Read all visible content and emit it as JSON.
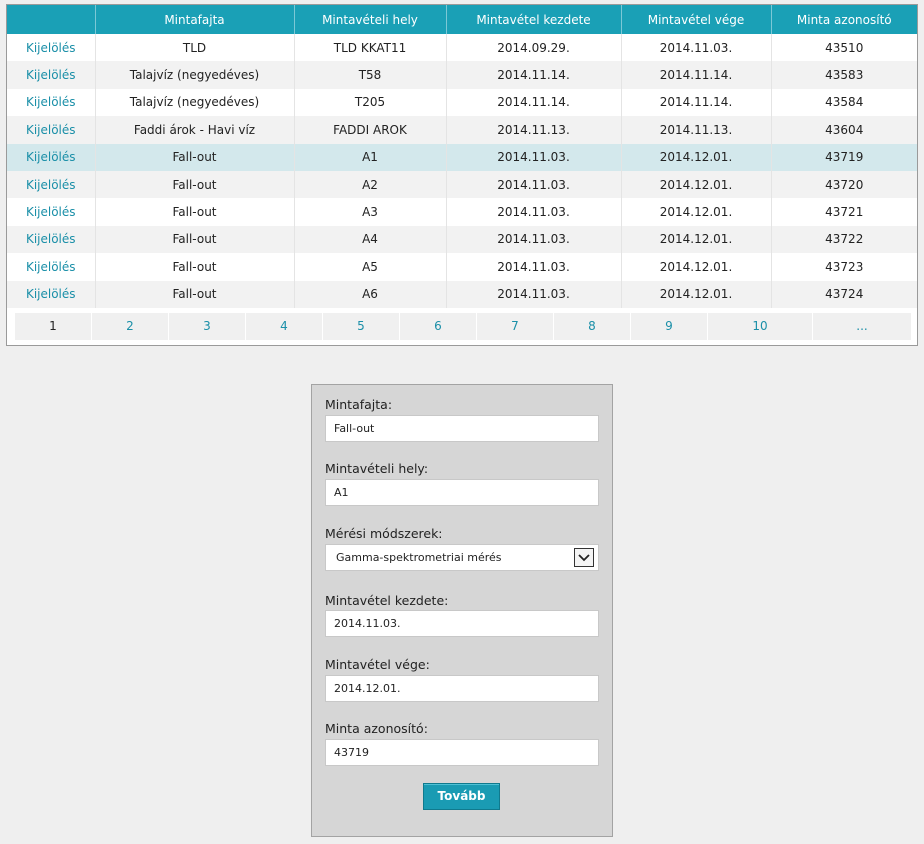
{
  "grid": {
    "columns": [
      "",
      "Mintafajta",
      "Mintavételi hely",
      "Mintavétel kezdete",
      "Mintavétel vége",
      "Minta azonosító"
    ],
    "rows": [
      {
        "action": "Kijelölés",
        "type": "TLD",
        "place": "TLD KKAT11",
        "start": "2014.09.29.",
        "end": "2014.11.03.",
        "id": "43510"
      },
      {
        "action": "Kijelölés",
        "type": "Talajvíz (negyedéves)",
        "place": "T58",
        "start": "2014.11.14.",
        "end": "2014.11.14.",
        "id": "43583"
      },
      {
        "action": "Kijelölés",
        "type": "Talajvíz (negyedéves)",
        "place": "T205",
        "start": "2014.11.14.",
        "end": "2014.11.14.",
        "id": "43584"
      },
      {
        "action": "Kijelölés",
        "type": "Faddi árok - Havi víz",
        "place": "FADDI AROK",
        "start": "2014.11.13.",
        "end": "2014.11.13.",
        "id": "43604"
      },
      {
        "action": "Kijelölés",
        "type": "Fall-out",
        "place": "A1",
        "start": "2014.11.03.",
        "end": "2014.12.01.",
        "id": "43719"
      },
      {
        "action": "Kijelölés",
        "type": "Fall-out",
        "place": "A2",
        "start": "2014.11.03.",
        "end": "2014.12.01.",
        "id": "43720"
      },
      {
        "action": "Kijelölés",
        "type": "Fall-out",
        "place": "A3",
        "start": "2014.11.03.",
        "end": "2014.12.01.",
        "id": "43721"
      },
      {
        "action": "Kijelölés",
        "type": "Fall-out",
        "place": "A4",
        "start": "2014.11.03.",
        "end": "2014.12.01.",
        "id": "43722"
      },
      {
        "action": "Kijelölés",
        "type": "Fall-out",
        "place": "A5",
        "start": "2014.11.03.",
        "end": "2014.12.01.",
        "id": "43723"
      },
      {
        "action": "Kijelölés",
        "type": "Fall-out",
        "place": "A6",
        "start": "2014.11.03.",
        "end": "2014.12.01.",
        "id": "43724"
      }
    ],
    "selected_row": 4
  },
  "pager": {
    "pages": [
      "1",
      "2",
      "3",
      "4",
      "5",
      "6",
      "7",
      "8",
      "9",
      "10",
      "..."
    ],
    "current": "1"
  },
  "form": {
    "type_label": "Mintafajta:",
    "type_value": "Fall-out",
    "place_label": "Mintavételi hely:",
    "place_value": "A1",
    "method_label": "Mérési módszerek:",
    "method_value": "Gamma-spektrometriai mérés",
    "start_label": "Mintavétel kezdete:",
    "start_value": "2014.11.03.",
    "end_label": "Mintavétel vége:",
    "end_value": "2014.12.01.",
    "id_label": "Minta azonosító:",
    "id_value": "43719",
    "next_button": "Tovább"
  },
  "colors": {
    "header_bg": "#1aa0b6",
    "link": "#1a8fa8",
    "selected_row_bg": "#d3e8ec",
    "panel_bg": "#d6d6d6"
  }
}
